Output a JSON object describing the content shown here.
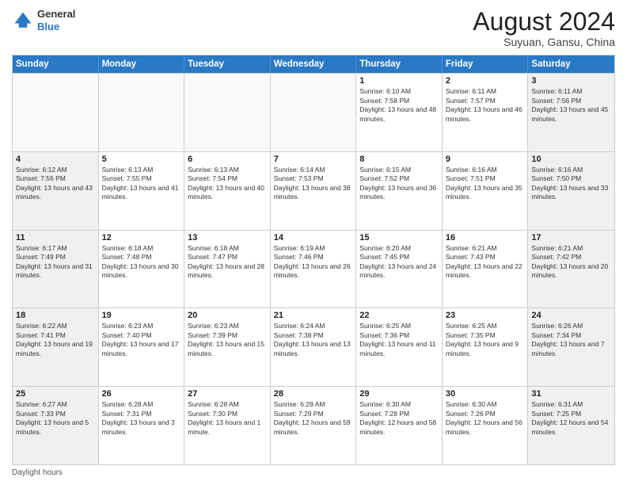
{
  "logo": {
    "general": "General",
    "blue": "Blue"
  },
  "title": {
    "main": "August 2024",
    "sub": "Suyuan, Gansu, China"
  },
  "weekdays": [
    "Sunday",
    "Monday",
    "Tuesday",
    "Wednesday",
    "Thursday",
    "Friday",
    "Saturday"
  ],
  "weeks": [
    [
      {
        "day": "",
        "info": "",
        "empty": true
      },
      {
        "day": "",
        "info": "",
        "empty": true
      },
      {
        "day": "",
        "info": "",
        "empty": true
      },
      {
        "day": "",
        "info": "",
        "empty": true
      },
      {
        "day": "1",
        "info": "Sunrise: 6:10 AM\nSunset: 7:58 PM\nDaylight: 13 hours and 48 minutes."
      },
      {
        "day": "2",
        "info": "Sunrise: 6:11 AM\nSunset: 7:57 PM\nDaylight: 13 hours and 46 minutes."
      },
      {
        "day": "3",
        "info": "Sunrise: 6:11 AM\nSunset: 7:56 PM\nDaylight: 13 hours and 45 minutes."
      }
    ],
    [
      {
        "day": "4",
        "info": "Sunrise: 6:12 AM\nSunset: 7:56 PM\nDaylight: 13 hours and 43 minutes."
      },
      {
        "day": "5",
        "info": "Sunrise: 6:13 AM\nSunset: 7:55 PM\nDaylight: 13 hours and 41 minutes."
      },
      {
        "day": "6",
        "info": "Sunrise: 6:13 AM\nSunset: 7:54 PM\nDaylight: 13 hours and 40 minutes."
      },
      {
        "day": "7",
        "info": "Sunrise: 6:14 AM\nSunset: 7:53 PM\nDaylight: 13 hours and 38 minutes."
      },
      {
        "day": "8",
        "info": "Sunrise: 6:15 AM\nSunset: 7:52 PM\nDaylight: 13 hours and 36 minutes."
      },
      {
        "day": "9",
        "info": "Sunrise: 6:16 AM\nSunset: 7:51 PM\nDaylight: 13 hours and 35 minutes."
      },
      {
        "day": "10",
        "info": "Sunrise: 6:16 AM\nSunset: 7:50 PM\nDaylight: 13 hours and 33 minutes."
      }
    ],
    [
      {
        "day": "11",
        "info": "Sunrise: 6:17 AM\nSunset: 7:49 PM\nDaylight: 13 hours and 31 minutes."
      },
      {
        "day": "12",
        "info": "Sunrise: 6:18 AM\nSunset: 7:48 PM\nDaylight: 13 hours and 30 minutes."
      },
      {
        "day": "13",
        "info": "Sunrise: 6:18 AM\nSunset: 7:47 PM\nDaylight: 13 hours and 28 minutes."
      },
      {
        "day": "14",
        "info": "Sunrise: 6:19 AM\nSunset: 7:46 PM\nDaylight: 13 hours and 26 minutes."
      },
      {
        "day": "15",
        "info": "Sunrise: 6:20 AM\nSunset: 7:45 PM\nDaylight: 13 hours and 24 minutes."
      },
      {
        "day": "16",
        "info": "Sunrise: 6:21 AM\nSunset: 7:43 PM\nDaylight: 13 hours and 22 minutes."
      },
      {
        "day": "17",
        "info": "Sunrise: 6:21 AM\nSunset: 7:42 PM\nDaylight: 13 hours and 20 minutes."
      }
    ],
    [
      {
        "day": "18",
        "info": "Sunrise: 6:22 AM\nSunset: 7:41 PM\nDaylight: 13 hours and 19 minutes."
      },
      {
        "day": "19",
        "info": "Sunrise: 6:23 AM\nSunset: 7:40 PM\nDaylight: 13 hours and 17 minutes."
      },
      {
        "day": "20",
        "info": "Sunrise: 6:23 AM\nSunset: 7:39 PM\nDaylight: 13 hours and 15 minutes."
      },
      {
        "day": "21",
        "info": "Sunrise: 6:24 AM\nSunset: 7:38 PM\nDaylight: 13 hours and 13 minutes."
      },
      {
        "day": "22",
        "info": "Sunrise: 6:25 AM\nSunset: 7:36 PM\nDaylight: 13 hours and 11 minutes."
      },
      {
        "day": "23",
        "info": "Sunrise: 6:25 AM\nSunset: 7:35 PM\nDaylight: 13 hours and 9 minutes."
      },
      {
        "day": "24",
        "info": "Sunrise: 6:26 AM\nSunset: 7:34 PM\nDaylight: 13 hours and 7 minutes."
      }
    ],
    [
      {
        "day": "25",
        "info": "Sunrise: 6:27 AM\nSunset: 7:33 PM\nDaylight: 13 hours and 5 minutes."
      },
      {
        "day": "26",
        "info": "Sunrise: 6:28 AM\nSunset: 7:31 PM\nDaylight: 13 hours and 3 minutes."
      },
      {
        "day": "27",
        "info": "Sunrise: 6:28 AM\nSunset: 7:30 PM\nDaylight: 13 hours and 1 minute."
      },
      {
        "day": "28",
        "info": "Sunrise: 6:29 AM\nSunset: 7:29 PM\nDaylight: 12 hours and 59 minutes."
      },
      {
        "day": "29",
        "info": "Sunrise: 6:30 AM\nSunset: 7:28 PM\nDaylight: 12 hours and 58 minutes."
      },
      {
        "day": "30",
        "info": "Sunrise: 6:30 AM\nSunset: 7:26 PM\nDaylight: 12 hours and 56 minutes."
      },
      {
        "day": "31",
        "info": "Sunrise: 6:31 AM\nSunset: 7:25 PM\nDaylight: 12 hours and 54 minutes."
      }
    ]
  ],
  "footer": {
    "daylight_label": "Daylight hours"
  }
}
